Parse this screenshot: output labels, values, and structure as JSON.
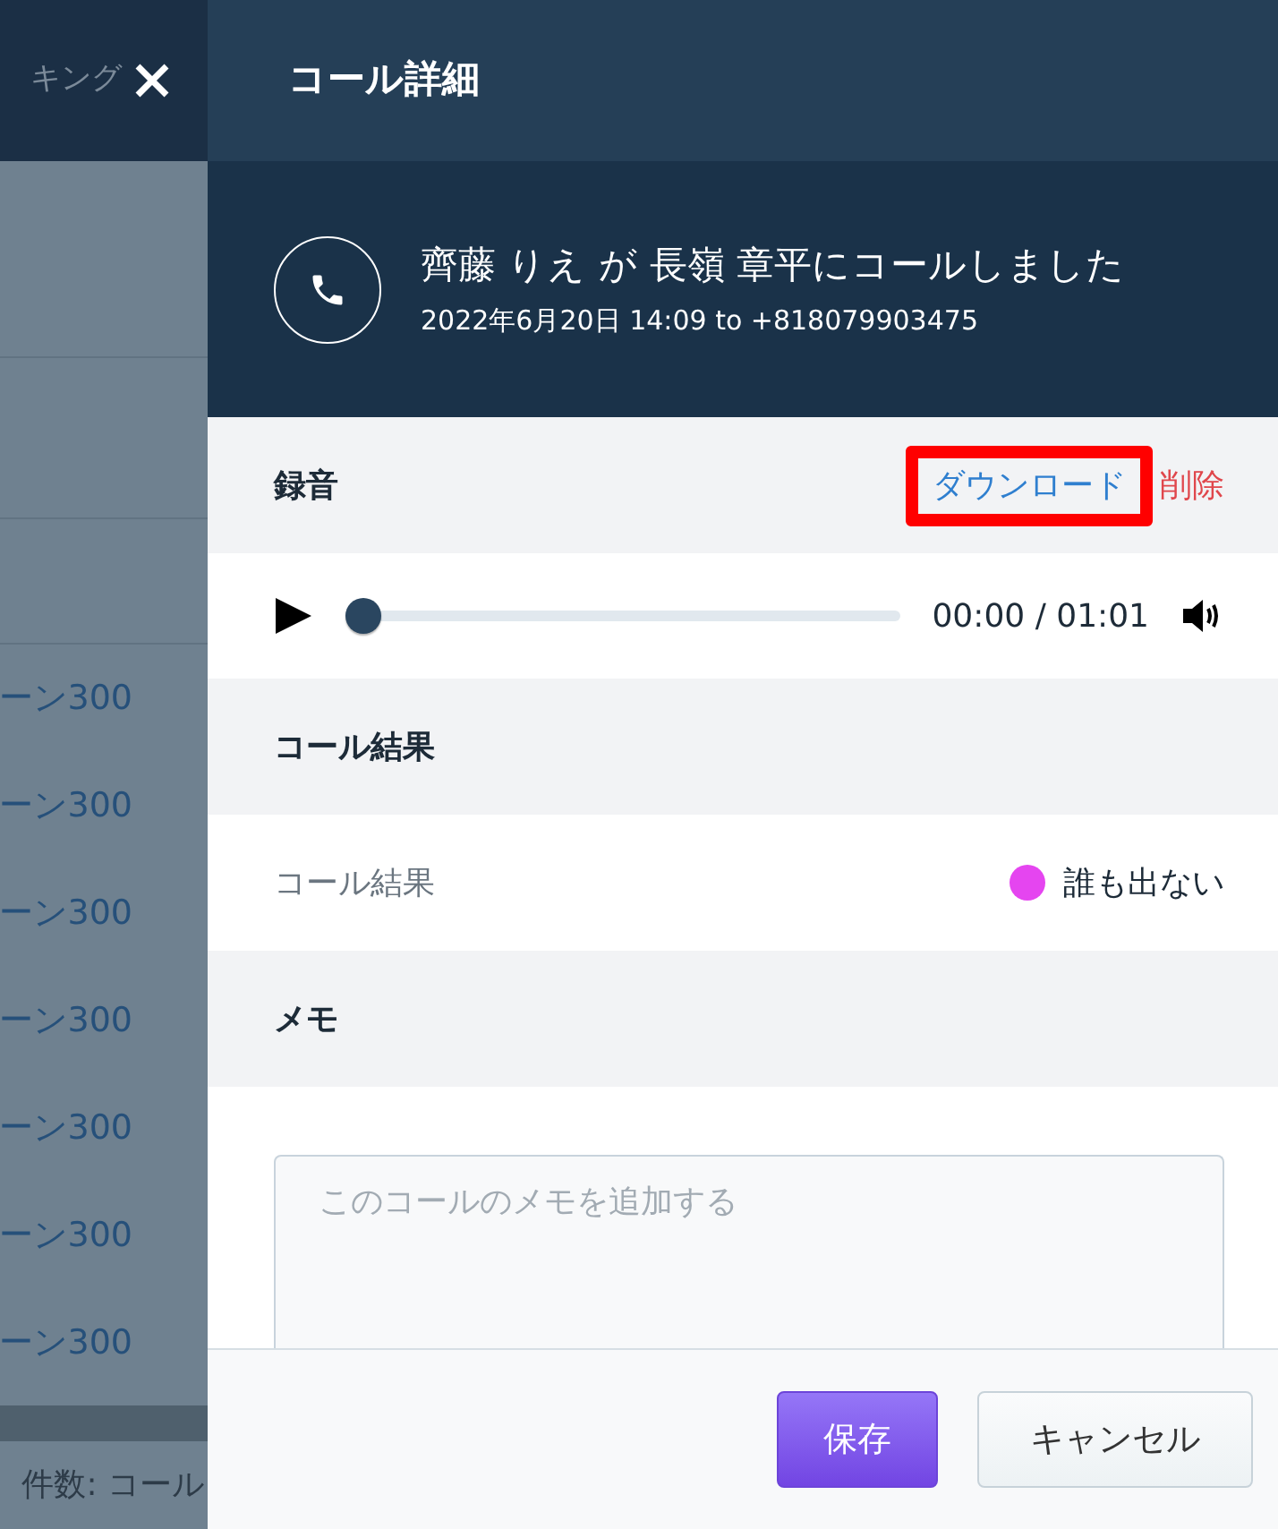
{
  "background": {
    "header_text": "キング",
    "rows": [
      "ーン300",
      "ーン300",
      "ーン300",
      "ーン300",
      "ーン300",
      "ーン300",
      "ーン300"
    ],
    "footer_text": "件数: コール"
  },
  "drawer": {
    "title": "コール詳細",
    "summary": {
      "headline": "齊藤 りえ が 長嶺 章平にコールしました",
      "detail": "2022年6月20日 14:09 to +818079903475"
    },
    "recording": {
      "title": "録音",
      "download": {
        "label": "ダウンロード",
        "highlighted": true
      },
      "delete_label": "削除",
      "player": {
        "level": 0,
        "time": "00:00 / 01:01"
      }
    },
    "call_result": {
      "title": "コール結果",
      "label": "コール結果",
      "value": "誰も出ない",
      "color": "#e545f0"
    },
    "memo": {
      "title": "メモ",
      "placeholder": "このコールのメモを追加する"
    },
    "buttons": [
      {
        "label": "保存",
        "kind": "primary"
      },
      {
        "label": "キャンセル",
        "kind": "secondary"
      }
    ]
  }
}
